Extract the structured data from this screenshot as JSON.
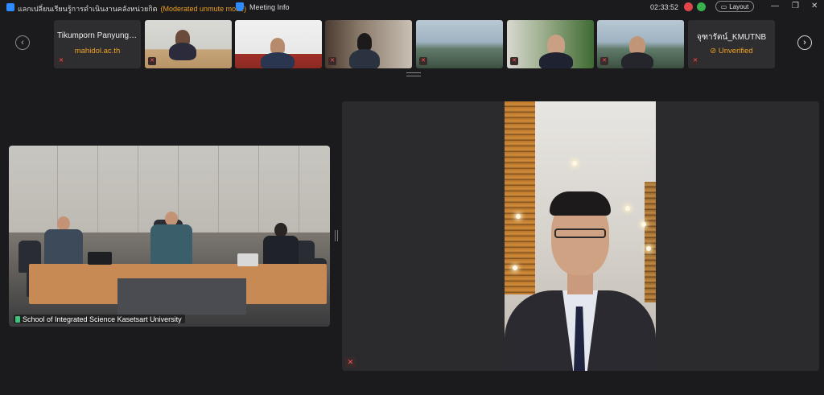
{
  "titlebar": {
    "meeting_title": "แลกเปลี่ยนเรียนรู้การดำเนินงานคลังหน่วยกิต",
    "mode": "(Moderated unmute mode)",
    "meeting_info": "Meeting Info",
    "timer": "02:33:52",
    "layout_label": "Layout",
    "minimize": "—",
    "restore": "❐",
    "close": "✕",
    "colors": {
      "record": "#e0454a",
      "security": "#37b24d",
      "accent": "#2d8cff",
      "mode": "#f0a020"
    }
  },
  "gallery": {
    "prev": "‹",
    "next": "›",
    "tiles": [
      {
        "name": "Tikumporn Panyungy...",
        "sub": "mahidol.ac.th",
        "muted": true
      },
      {
        "video": true,
        "muted": true
      },
      {
        "video": true,
        "muted": false
      },
      {
        "video": true,
        "muted": true
      },
      {
        "video": true,
        "muted": true
      },
      {
        "video": true,
        "muted": true
      },
      {
        "video": true,
        "muted": true
      },
      {
        "name": "จุฑารัตน์_KMUTNB",
        "sub": "Unverified",
        "muted": true
      }
    ]
  },
  "main": {
    "left_video": {
      "name": "School of Integrated Science Kasetsart University"
    },
    "right_video": {
      "muted": true
    }
  },
  "icons": {
    "muted_mic": "mic-off-icon",
    "unverified": "warning-icon"
  }
}
